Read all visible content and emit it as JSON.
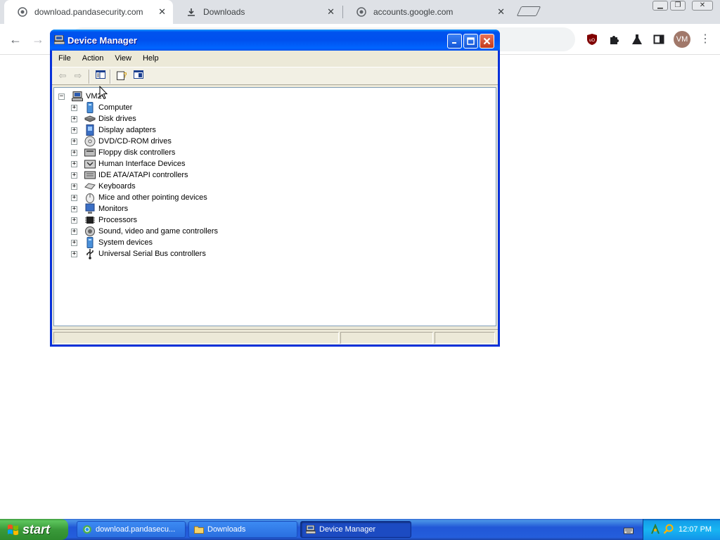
{
  "browser": {
    "tabs": [
      {
        "title": "download.pandasecurity.com",
        "icon": "globe-icon",
        "active": true
      },
      {
        "title": "Downloads",
        "icon": "download-icon",
        "active": false
      },
      {
        "title": "accounts.google.com",
        "icon": "globe-icon",
        "active": false
      }
    ],
    "avatar_initials": "VM",
    "extensions": [
      "ublock-icon",
      "puzzle-icon",
      "flask-icon",
      "sidepanel-icon"
    ]
  },
  "device_manager": {
    "title": "Device Manager",
    "menu": [
      "File",
      "Action",
      "View",
      "Help"
    ],
    "root": "VM2-",
    "items": [
      {
        "label": "Computer",
        "icon": "computer-icon"
      },
      {
        "label": "Disk drives",
        "icon": "disk-drive-icon"
      },
      {
        "label": "Display adapters",
        "icon": "display-adapter-icon"
      },
      {
        "label": "DVD/CD-ROM drives",
        "icon": "dvd-icon"
      },
      {
        "label": "Floppy disk controllers",
        "icon": "floppy-controller-icon"
      },
      {
        "label": "Human Interface Devices",
        "icon": "hid-icon"
      },
      {
        "label": "IDE ATA/ATAPI controllers",
        "icon": "ide-controller-icon"
      },
      {
        "label": "Keyboards",
        "icon": "keyboard-icon"
      },
      {
        "label": "Mice and other pointing devices",
        "icon": "mouse-icon"
      },
      {
        "label": "Monitors",
        "icon": "monitor-icon"
      },
      {
        "label": "Processors",
        "icon": "processor-icon"
      },
      {
        "label": "Sound, video and game controllers",
        "icon": "sound-icon"
      },
      {
        "label": "System devices",
        "icon": "system-devices-icon"
      },
      {
        "label": "Universal Serial Bus controllers",
        "icon": "usb-icon"
      }
    ]
  },
  "taskbar": {
    "start_label": "start",
    "buttons": [
      {
        "label": "download.pandasecu...",
        "icon": "browser-icon",
        "active": false
      },
      {
        "label": "Downloads",
        "icon": "folder-icon",
        "active": false
      },
      {
        "label": "Device Manager",
        "icon": "device-manager-icon",
        "active": true
      }
    ],
    "clock": "12:07 PM"
  },
  "colors": {
    "xp_title_blue": "#0054e3",
    "xp_taskbar_blue": "#245edc",
    "xp_start_green": "#3a9a3a",
    "xp_close_red": "#c4391c"
  }
}
